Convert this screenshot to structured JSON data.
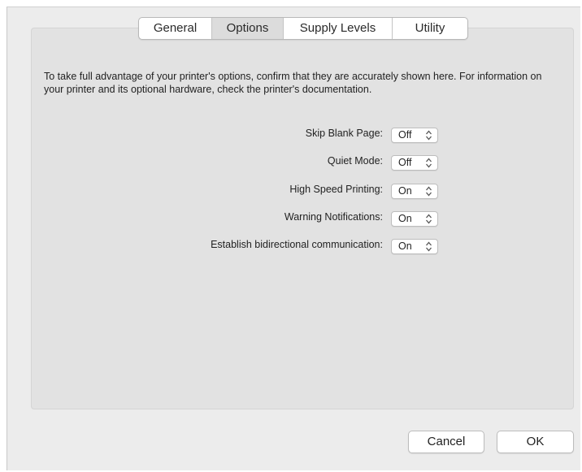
{
  "tabs": [
    {
      "label": "General",
      "active": false
    },
    {
      "label": "Options",
      "active": true
    },
    {
      "label": "Supply Levels",
      "active": false
    },
    {
      "label": "Utility",
      "active": false
    }
  ],
  "intro_text": "To take full advantage of your printer's options, confirm that they are accurately shown here. For information on your printer and its optional hardware, check the printer's documentation.",
  "options": [
    {
      "label": "Skip Blank Page:",
      "value": "Off"
    },
    {
      "label": "Quiet Mode:",
      "value": "Off"
    },
    {
      "label": "High Speed Printing:",
      "value": "On"
    },
    {
      "label": "Warning Notifications:",
      "value": "On"
    },
    {
      "label": "Establish bidirectional communication:",
      "value": "On"
    }
  ],
  "buttons": {
    "cancel_label": "Cancel",
    "ok_label": "OK"
  },
  "icons": {
    "popup": "up-down-chevron-icon"
  }
}
